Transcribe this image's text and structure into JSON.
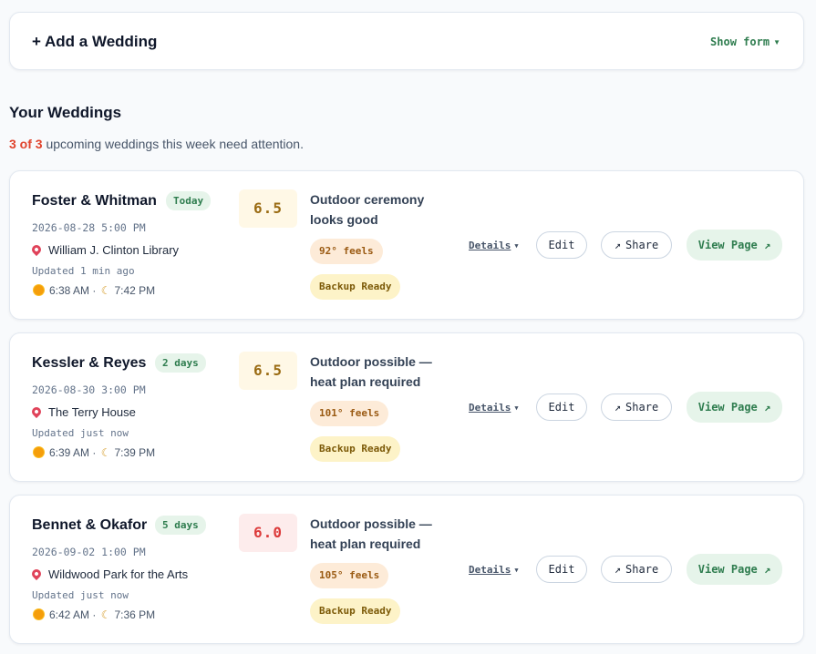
{
  "add_wedding": {
    "title": "+ Add a Wedding",
    "toggle_label": "Show form"
  },
  "section": {
    "title": "Your Weddings",
    "attention_count": "3 of 3",
    "attention_text": "upcoming weddings this week need attention."
  },
  "weddings": [
    {
      "names": "Foster & Whitman",
      "days_badge": "Today",
      "datetime": "2026-08-28 5:00 PM",
      "venue": "William J. Clinton Library",
      "updated": "Updated 1 min ago",
      "sunrise": "6:38 AM",
      "sunset": "7:42 PM",
      "score": "6.5",
      "score_color": "#9a6b12",
      "verdict": "Outdoor ceremony looks good",
      "feels": "92° feels",
      "backup": "Backup Ready",
      "details_label": "Details",
      "edit_label": "Edit",
      "share_label": "Share",
      "view_label": "View Page"
    },
    {
      "names": "Kessler & Reyes",
      "days_badge": "2 days",
      "datetime": "2026-08-30 3:00 PM",
      "venue": "The Terry House",
      "updated": "Updated just now",
      "sunrise": "6:39 AM",
      "sunset": "7:39 PM",
      "score": "6.5",
      "score_color": "#9a6b12",
      "verdict": "Outdoor possible — heat plan required",
      "feels": "101° feels",
      "backup": "Backup Ready",
      "details_label": "Details",
      "edit_label": "Edit",
      "share_label": "Share",
      "view_label": "View Page"
    },
    {
      "names": "Bennet & Okafor",
      "days_badge": "5 days",
      "datetime": "2026-09-02 1:00 PM",
      "venue": "Wildwood Park for the Arts",
      "updated": "Updated just now",
      "sunrise": "6:42 AM",
      "sunset": "7:36 PM",
      "score": "6.0",
      "score_color": "#dc3b3b",
      "verdict": "Outdoor possible — heat plan required",
      "feels": "105° feels",
      "backup": "Backup Ready",
      "details_label": "Details",
      "edit_label": "Edit",
      "share_label": "Share",
      "view_label": "View Page"
    }
  ]
}
